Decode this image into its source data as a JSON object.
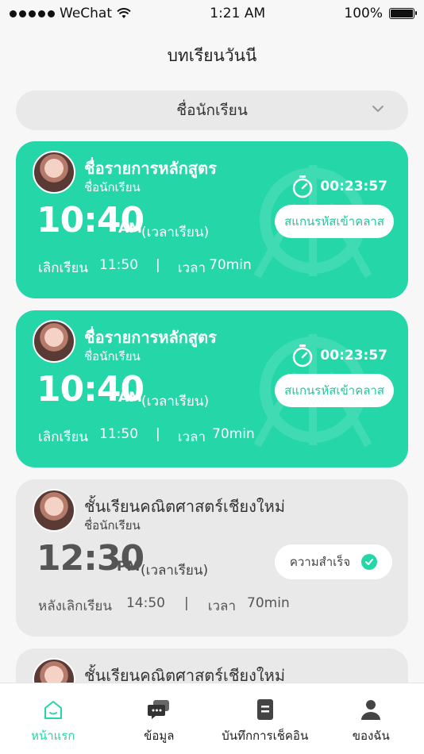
{
  "status_bar": {
    "carrier": "WeChat",
    "time": "1:21 AM",
    "battery": "100%"
  },
  "page": {
    "title": "บทเรียนวันนี"
  },
  "dropdown": {
    "selected": "ชื่อนักเรียน"
  },
  "cards": [
    {
      "state": "active",
      "title": "ชื่อรายการหลักสูตร",
      "student": "ชื่อนักเรียน",
      "time": "10:40",
      "ampm": "AM",
      "time_label": "(เวลาเรียน)",
      "countdown": "00:23:57",
      "scan_button": "สแกนรหัสเข้าคลาส",
      "end_label": "เลิกเรียน",
      "end_time": "11:50",
      "duration_label": "เวลา",
      "duration": "70min"
    },
    {
      "state": "active",
      "title": "ชื่อรายการหลักสูตร",
      "student": "ชื่อนักเรียน",
      "time": "10:40",
      "ampm": "AM",
      "time_label": "(เวลาเรียน)",
      "countdown": "00:23:57",
      "scan_button": "สแกนรหัสเข้าคลาส",
      "end_label": "เลิกเรียน",
      "end_time": "11:50",
      "duration_label": "เวลา",
      "duration": "70min"
    },
    {
      "state": "done",
      "title": "ชั้นเรียนคณิตศาสตร์เชียงใหม่",
      "student": "ชื่อนักเรียน",
      "time": "12:30",
      "ampm": "PM",
      "time_label": "(เวลาเรียน)",
      "done_button": "ความสำเร็จ",
      "end_label": "หลังเลิกเรียน",
      "end_time": "14:50",
      "duration_label": "เวลา",
      "duration": "70min"
    },
    {
      "state": "done",
      "title": "ชั้นเรียนคณิตศาสตร์เชียงใหม่"
    }
  ],
  "tabbar": {
    "items": [
      {
        "label": "หน้าแรก",
        "icon": "home-icon"
      },
      {
        "label": "ข้อมูล",
        "icon": "chat-icon"
      },
      {
        "label": "บันทึกการเช็คอิน",
        "icon": "record-icon"
      },
      {
        "label": "ของฉัน",
        "icon": "user-icon"
      }
    ]
  },
  "colors": {
    "accent": "#25d6a8",
    "card_inactive": "#e9e9e9"
  }
}
